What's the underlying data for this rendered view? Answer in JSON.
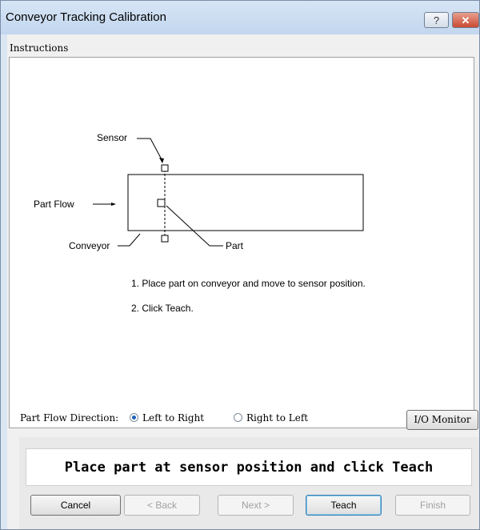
{
  "window": {
    "title": "Conveyor Tracking Calibration",
    "help_glyph": "?",
    "close_glyph": "✕"
  },
  "instructions": {
    "group_label": "Instructions",
    "diagram": {
      "sensor": "Sensor",
      "part_flow": "Part Flow",
      "conveyor": "Conveyor",
      "part": "Part"
    },
    "steps": [
      "1. Place part on conveyor and move to sensor position.",
      "2. Click Teach."
    ]
  },
  "direction": {
    "label": "Part Flow Direction:",
    "options": [
      {
        "label": "Left to Right",
        "selected": true
      },
      {
        "label": "Right to Left",
        "selected": false
      }
    ]
  },
  "io_monitor_label": "I/O Monitor",
  "status_message": "Place part at sensor position and click Teach",
  "buttons": {
    "cancel": "Cancel",
    "back": "< Back",
    "next": "Next >",
    "teach": "Teach",
    "finish": "Finish"
  },
  "colors": {
    "accent": "#1d5fb8",
    "titlebar": "#c2d6ee",
    "close": "#c94a32"
  }
}
